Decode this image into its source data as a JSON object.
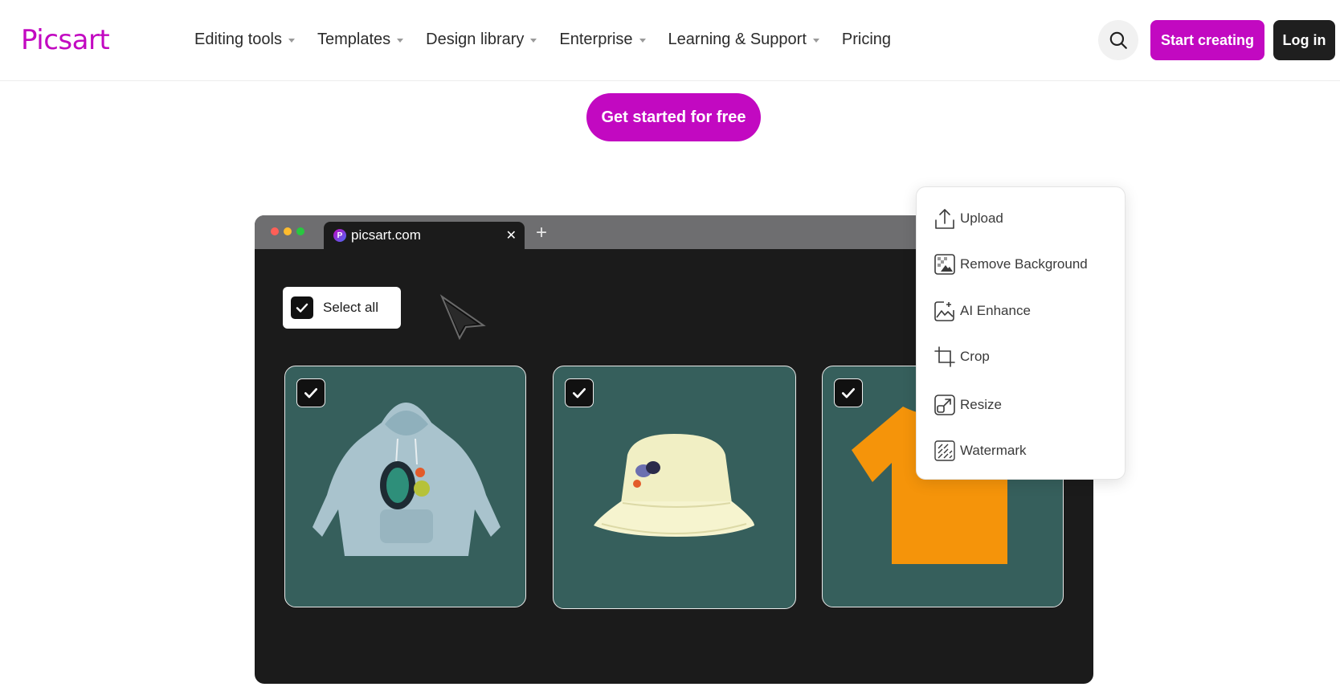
{
  "brand": {
    "name": "Picsart",
    "color": "#c209c1"
  },
  "nav": {
    "items": [
      {
        "label": "Editing tools",
        "dropdown": true
      },
      {
        "label": "Templates",
        "dropdown": true
      },
      {
        "label": "Design library",
        "dropdown": true
      },
      {
        "label": "Enterprise",
        "dropdown": true
      },
      {
        "label": "Learning & Support",
        "dropdown": true
      },
      {
        "label": "Pricing",
        "dropdown": false
      }
    ],
    "search_icon": "search-icon",
    "start_label": "Start creating",
    "login_label": "Log in"
  },
  "hero": {
    "cta_label": "Get started for free"
  },
  "browser": {
    "tab_title": "picsart.com",
    "favicon_letter": "P",
    "select_all_label": "Select all",
    "cards": [
      {
        "product": "hoodie",
        "selected": true
      },
      {
        "product": "bucket-hat",
        "selected": true
      },
      {
        "product": "t-shirt",
        "selected": true
      }
    ]
  },
  "menu": {
    "items": [
      {
        "label": "Upload",
        "icon": "upload-icon"
      },
      {
        "label": "Remove Background",
        "icon": "remove-background-icon"
      },
      {
        "label": "AI Enhance",
        "icon": "ai-enhance-icon"
      },
      {
        "label": "Crop",
        "icon": "crop-icon"
      },
      {
        "label": "Resize",
        "icon": "resize-icon"
      },
      {
        "label": "Watermark",
        "icon": "watermark-icon"
      }
    ]
  }
}
